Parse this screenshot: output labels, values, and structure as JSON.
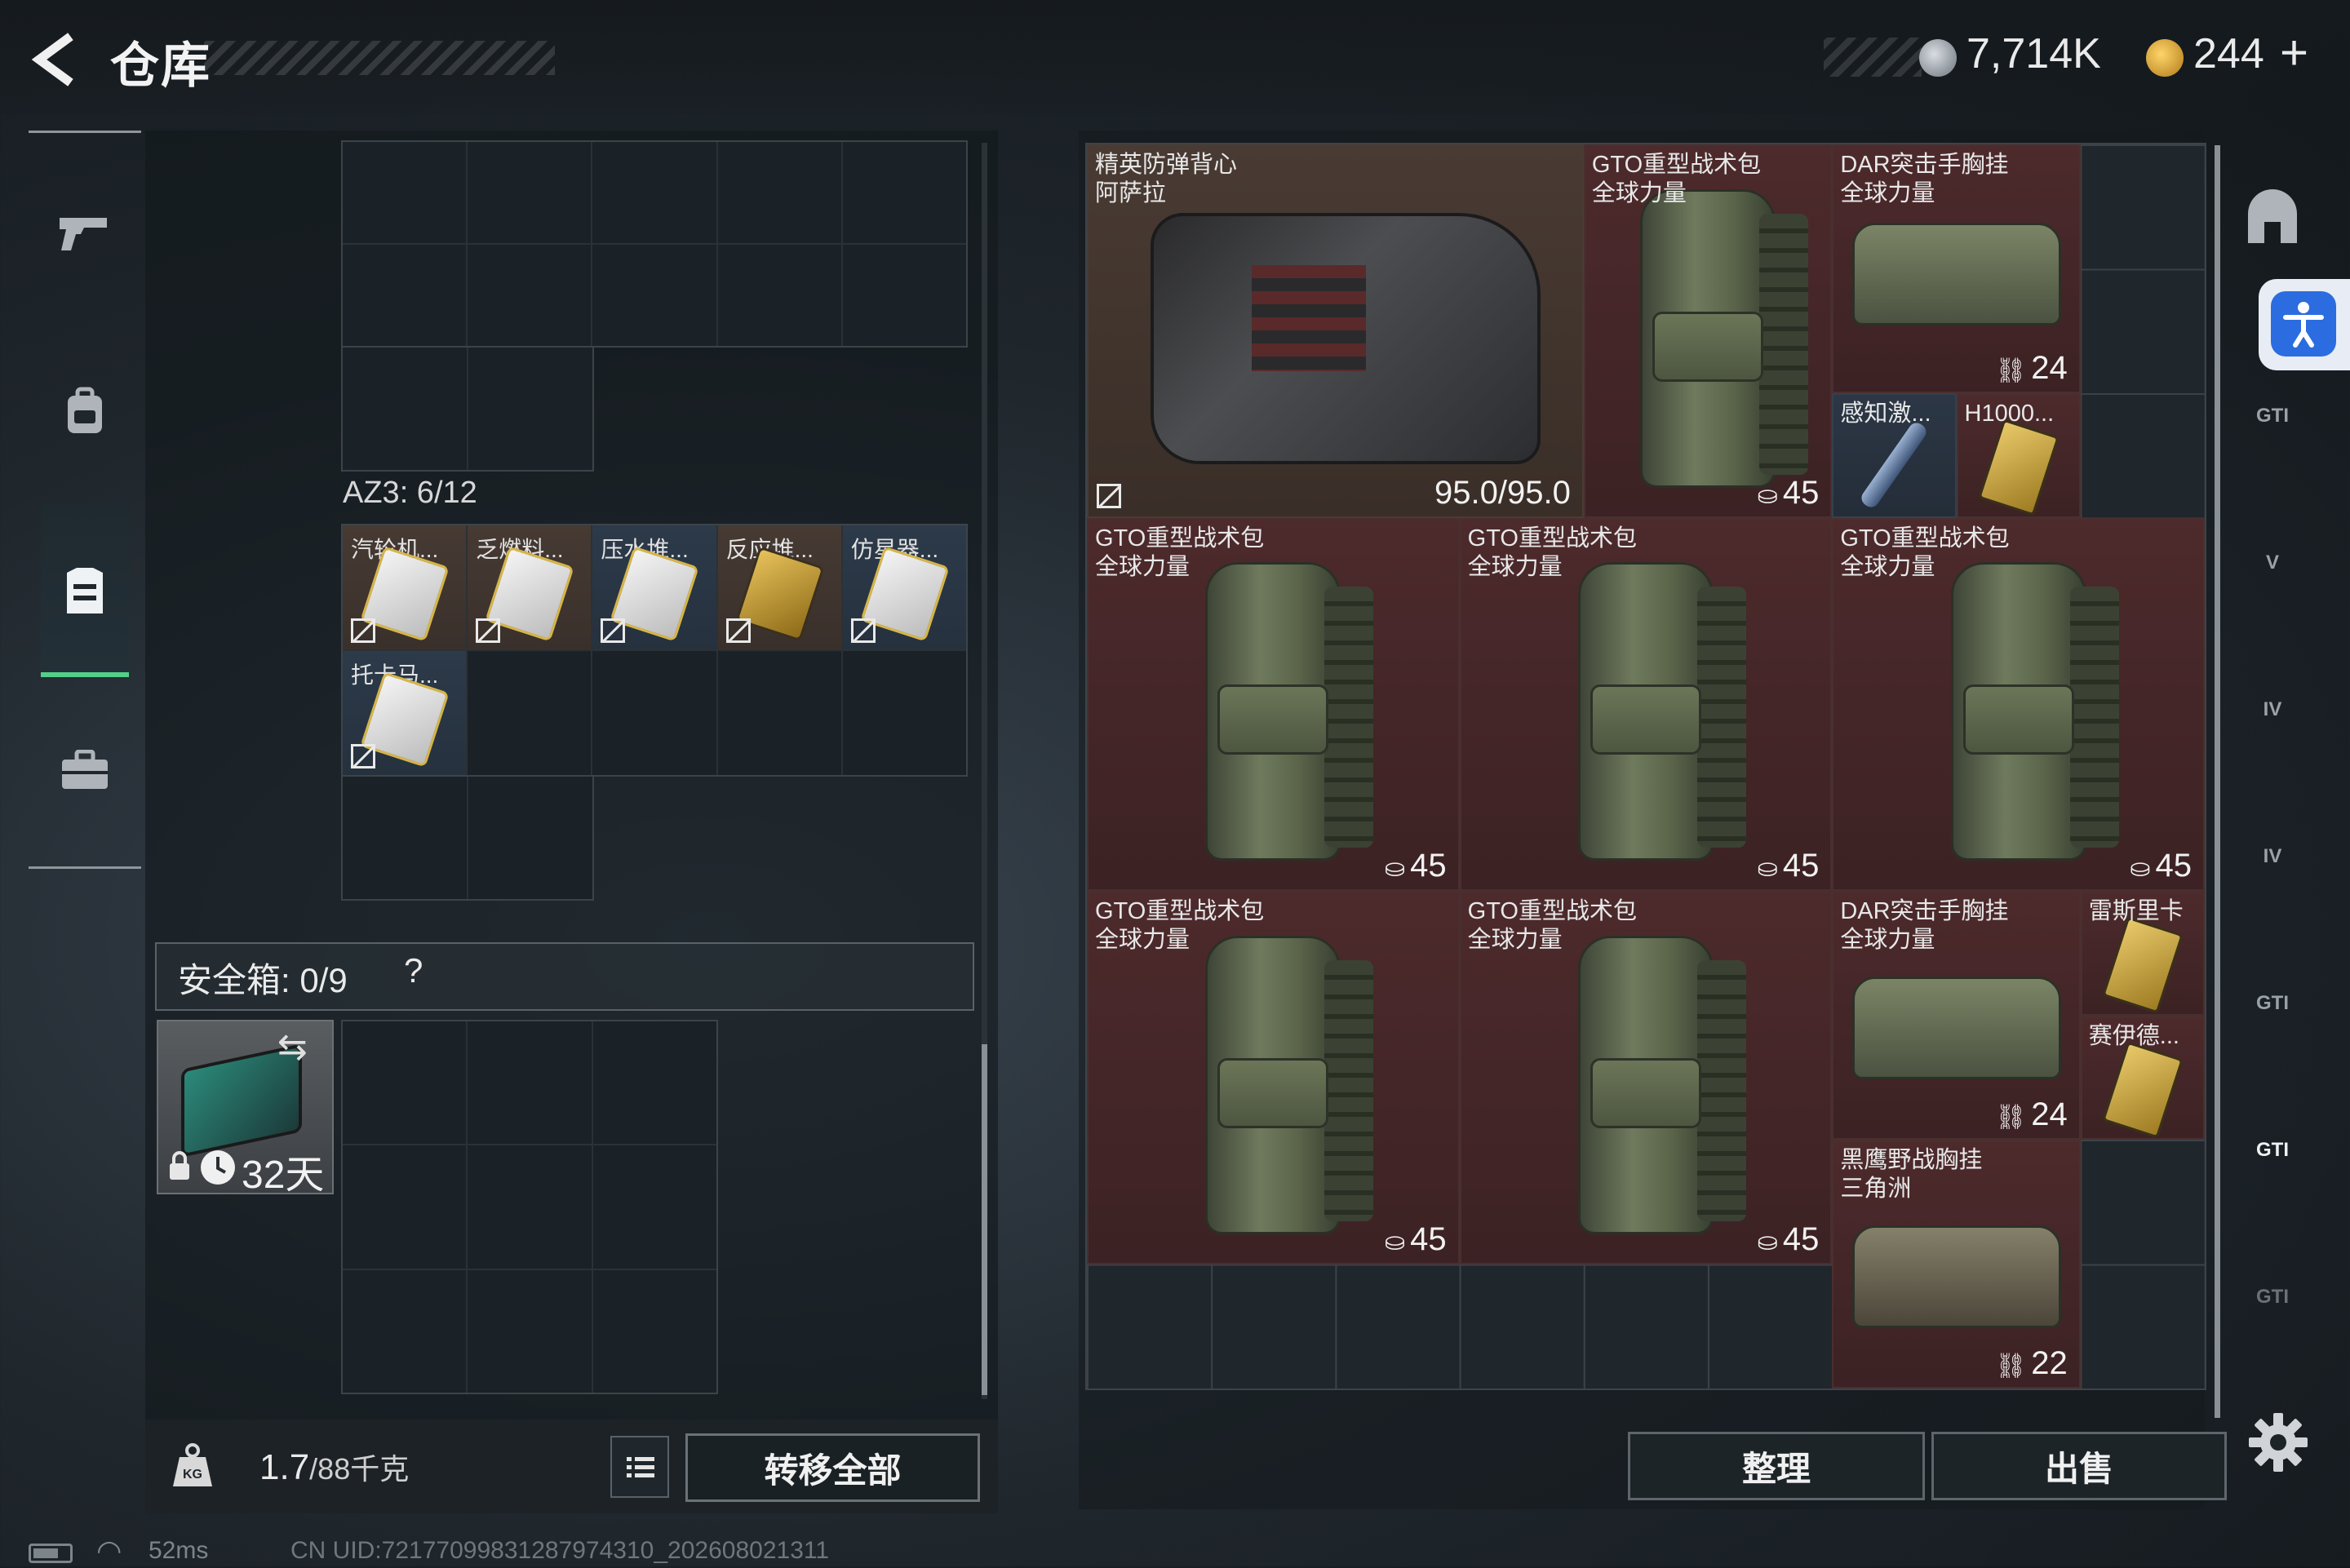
{
  "header": {
    "title": "仓库",
    "currency_silver": "7,714K",
    "currency_gold": "244",
    "add_label": "+"
  },
  "left_nav": {
    "items": [
      {
        "icon": "pistol-icon"
      },
      {
        "icon": "backpack-icon"
      },
      {
        "icon": "vest-icon",
        "active": true
      },
      {
        "icon": "toolbox-icon"
      }
    ]
  },
  "backpack": {
    "az3_label": "AZ3: 6/12",
    "slots": [
      {
        "name": "汽轮机...",
        "style": "brown"
      },
      {
        "name": "乏燃料...",
        "style": "brown"
      },
      {
        "name": "压水堆...",
        "style": "blue"
      },
      {
        "name": "反应堆...",
        "style": "brown",
        "gold": true
      },
      {
        "name": "仿星器...",
        "style": "blue"
      },
      {
        "name": "托卡马...",
        "style": "blue"
      }
    ]
  },
  "safe": {
    "label": "安全箱: 0/9",
    "help": "?",
    "swap_icon": "⇆",
    "days": "32天"
  },
  "footer_left": {
    "weight": "1.7",
    "capacity": "/88千克",
    "transfer_all": "转移全部"
  },
  "warehouse": {
    "items": [
      {
        "name": "精英防弹背心\n阿萨拉",
        "value": "95.0/95.0",
        "kind": "vest",
        "style": "brown"
      },
      {
        "name": "GTO重型战术包\n全球力量",
        "value": "45",
        "kind": "pack"
      },
      {
        "name": "DAR突击手胸挂\n全球力量",
        "value": "24",
        "kind": "rig"
      },
      {
        "name": "感知激...",
        "kind": "stick",
        "style": "blue"
      },
      {
        "name": "H1000...",
        "kind": "card"
      },
      {
        "name": "GTO重型战术包\n全球力量",
        "value": "45",
        "kind": "pack"
      },
      {
        "name": "GTO重型战术包\n全球力量",
        "value": "45",
        "kind": "pack"
      },
      {
        "name": "GTO重型战术包\n全球力量",
        "value": "45",
        "kind": "pack"
      },
      {
        "name": "GTO重型战术包\n全球力量",
        "value": "45",
        "kind": "pack"
      },
      {
        "name": "GTO重型战术包\n全球力量",
        "value": "45",
        "kind": "pack"
      },
      {
        "name": "DAR突击手胸挂\n全球力量",
        "value": "24",
        "kind": "rig"
      },
      {
        "name": "雷斯里卡",
        "kind": "card"
      },
      {
        "name": "赛伊德...",
        "kind": "card"
      },
      {
        "name": "黑鹰野战胸挂\n三角洲",
        "value": "22",
        "kind": "rig-dark"
      }
    ],
    "sort_label": "整理",
    "sell_label": "出售"
  },
  "right_nav": {
    "items": [
      {
        "icon": "armor-icon",
        "label": ""
      },
      {
        "icon": "gti-weapon-icon",
        "label": "GTI"
      },
      {
        "icon": "v-weapon-icon",
        "label": "V"
      },
      {
        "icon": "iv-weapon-icon",
        "label": "IV"
      },
      {
        "icon": "iv-folder-icon",
        "label": "IV"
      },
      {
        "icon": "gti-tag-icon",
        "label": "GTI"
      },
      {
        "icon": "gti-gear-icon",
        "label": "GTI"
      },
      {
        "icon": "gti-misc-icon",
        "label": "GTI"
      }
    ]
  },
  "status": {
    "ping": "52ms",
    "uid": "CN UID:72177099831287974310_202608021311"
  },
  "colors": {
    "accent_green": "#52d08a",
    "item_red": "#4d2a2c",
    "item_brown": "#493b33",
    "item_blue": "#2c3746"
  }
}
